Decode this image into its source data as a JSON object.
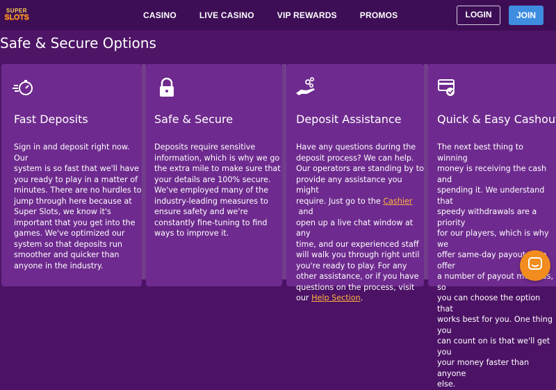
{
  "brand": {
    "line1": "SUPER",
    "line2": "SLOTS"
  },
  "nav": {
    "items": [
      "CASINO",
      "LIVE CASINO",
      "VIP REWARDS",
      "PROMOS"
    ],
    "login_label": "LOGIN",
    "join_label": "JOIN"
  },
  "section": {
    "title": "Safe & Secure Options"
  },
  "cards": [
    {
      "icon": "stopwatch-speed-icon",
      "title": "Fast Deposits",
      "lines": [
        "Sign in and deposit right now. Our",
        "system is so fast that we'll have",
        "you ready to play in a matter of",
        "minutes. There are no hurdles to",
        "jump through here because at",
        "Super Slots, we know it's",
        "important that you get into the",
        "games. We've optimized our",
        "system so that deposits run",
        "smoother and quicker than",
        "anyone in the industry."
      ]
    },
    {
      "icon": "padlock-icon",
      "title": "Safe & Secure",
      "lines": [
        "Deposits require sensitive",
        "information, which is why we go",
        "the extra mile to make sure that",
        "your details are 100% secure.",
        "We've employed many of the",
        "industry-leading measures to",
        "ensure safety and we're",
        "constantly fine-tuning to find",
        "ways to improve it."
      ]
    },
    {
      "icon": "hand-coins-icon",
      "title": "Deposit Assistance",
      "lines_pre": [
        "Have any questions during the",
        "deposit process? We can help.",
        "Our operators are standing by to",
        "provide any assistance you might"
      ],
      "line_cashier_before": "require. Just go to the ",
      "cashier_link": "Cashier",
      "line_cashier_after": " and",
      "lines_mid": [
        "open up a live chat window at any",
        "time, and our experienced staff",
        "will walk you through right until",
        "you're ready to play. For any",
        "other assistance, or if you have",
        "questions on the process, visit"
      ],
      "line_help_before": "our ",
      "help_link": "Help Section",
      "line_help_after": "."
    },
    {
      "icon": "card-cashout-icon",
      "title": "Quick & Easy Cashouts",
      "lines": [
        "The next best thing to winning",
        "money is receiving the cash and",
        "spending it. We understand that",
        "speedy withdrawals are a priority",
        "for our players, which is why we",
        "offer same-day payouts. We offer",
        "a number of payout methods, so",
        "you can choose the option that",
        "works best for you. One thing you",
        "can count on is that we'll get you",
        "your money faster than anyone",
        "else."
      ]
    }
  ],
  "colors": {
    "header_bg": "#3d0e55",
    "page_bg": "#4e1466",
    "card_bg": "#6e2a8e",
    "join_bg": "#3f8de0",
    "link": "#ffb43d",
    "chat_bg": "#f28c1e"
  },
  "chat": {
    "icon": "chat-bubble-icon"
  }
}
